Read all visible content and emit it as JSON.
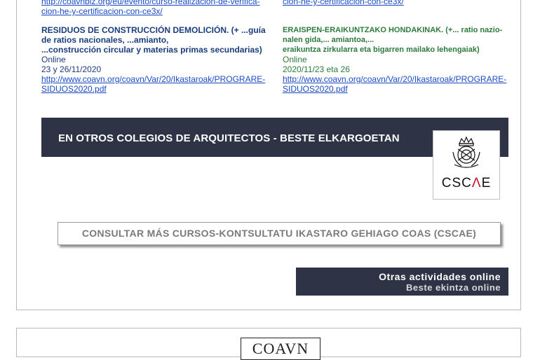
{
  "top_links": {
    "left": "http://coavnbiz.org/eu/evento/curso-realizacion-de-verifica-",
    "left2": "cion-he-y-certificacion-con-ce3x/",
    "right": "cion-he-y-certificacion-con-ce3x/"
  },
  "course_left": {
    "title1": "RESIDUOS DE CONSTRUCCIÓN DEMOLICIÓN. (+ ...guía",
    "title2": "de ratios nacionales, ...amianto,",
    "title3": "...construcción circular y materias primas secundarias)",
    "mode": "Online",
    "date": "23 y 26/11/2020",
    "link1": "http://www.coavn.org/coavn/Var/20/Ikastaroak/PROGRARE-",
    "link2": "SIDUOS2020.pdf"
  },
  "course_right": {
    "title1": "ERAISPEN-ERAIKUNTZAKO HONDAKINAK. (+... ratio nazio-",
    "title2": "nalen gida,... amiantoa,...",
    "title3": "eraikuntza zirkularra eta bigarren mailako lehengaiak)",
    "mode": "Online",
    "date": "2020/11/23 eta 26",
    "link1": "http://www.coavn.org/coavn/Var/20/Ikastaroak/PROGRARE-",
    "link2": "SIDUOS2020.pdf"
  },
  "banner": {
    "text": "EN OTROS COLEGIOS DE ARQUITECTOS - BESTE ELKARGOETAN",
    "logo_text_a": "CSC",
    "logo_text_accent": "Λ",
    "logo_text_b": "E"
  },
  "consult_button": "CONSULTAR MÁS CURSOS-KONTSULTATU IKASTARO GEHIAGO COAS (CSCAE)",
  "otras_button": {
    "line1": "Otras actividades online",
    "line2": "Beste ekintza online"
  },
  "footer_logo": "COAVN",
  "colors": {
    "navy": "#2e3446",
    "title_blue": "#1a3d7c",
    "title_green": "#2d7a3c",
    "link": "#1a4bc4"
  }
}
